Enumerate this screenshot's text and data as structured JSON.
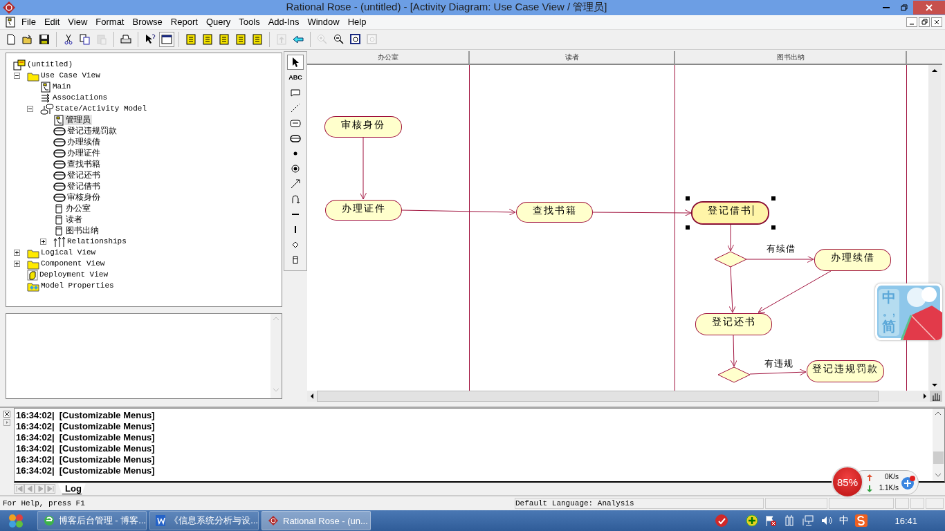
{
  "window": {
    "title": "Rational Rose - (untitled) - [Activity Diagram: Use Case View / 管理员]"
  },
  "menu": [
    "File",
    "Edit",
    "View",
    "Format",
    "Browse",
    "Report",
    "Query",
    "Tools",
    "Add-Ins",
    "Window",
    "Help"
  ],
  "toolbar": [
    {
      "kind": "new",
      "disabled": false,
      "pressed": false
    },
    {
      "kind": "open",
      "disabled": false,
      "pressed": false
    },
    {
      "kind": "save",
      "disabled": false,
      "pressed": false
    },
    {
      "kind": "separator"
    },
    {
      "kind": "cut",
      "disabled": false,
      "pressed": false
    },
    {
      "kind": "copy",
      "disabled": false,
      "pressed": false
    },
    {
      "kind": "paste",
      "disabled": true,
      "pressed": false
    },
    {
      "kind": "separator"
    },
    {
      "kind": "print",
      "disabled": false,
      "pressed": false
    },
    {
      "kind": "separator"
    },
    {
      "kind": "help",
      "disabled": false,
      "pressed": false
    },
    {
      "kind": "window",
      "disabled": false,
      "pressed": true
    },
    {
      "kind": "separator"
    },
    {
      "kind": "diagram",
      "disabled": false,
      "pressed": false
    },
    {
      "kind": "diagram",
      "disabled": false,
      "pressed": false
    },
    {
      "kind": "diagram",
      "disabled": false,
      "pressed": false
    },
    {
      "kind": "diagram",
      "disabled": false,
      "pressed": false
    },
    {
      "kind": "diagram",
      "disabled": false,
      "pressed": false
    },
    {
      "kind": "separator"
    },
    {
      "kind": "up",
      "disabled": true,
      "pressed": false
    },
    {
      "kind": "back",
      "disabled": false,
      "pressed": false
    },
    {
      "kind": "separator"
    },
    {
      "kind": "zoom-in",
      "disabled": true,
      "pressed": false
    },
    {
      "kind": "zoom-out",
      "disabled": false,
      "pressed": false
    },
    {
      "kind": "fit",
      "disabled": false,
      "pressed": false
    },
    {
      "kind": "fit",
      "disabled": true,
      "pressed": false
    }
  ],
  "browser": {
    "tree": {
      "label": "(untitled)",
      "kind": "model",
      "selected": false,
      "children": [
        {
          "label": "Use Case View",
          "kind": "folder",
          "expanded": true,
          "selected": false,
          "children": [
            {
              "label": "Main",
              "kind": "diagram",
              "selected": false
            },
            {
              "label": "Associations",
              "kind": "associations",
              "selected": false
            },
            {
              "label": "State/Activity Model",
              "kind": "state-model",
              "expanded": true,
              "selected": false,
              "children": [
                {
                  "label": "管理员",
                  "kind": "diagram",
                  "selected": true
                },
                {
                  "label": "登记违规罚款",
                  "kind": "activity",
                  "selected": false
                },
                {
                  "label": "办理续借",
                  "kind": "activity",
                  "selected": false
                },
                {
                  "label": "办理证件",
                  "kind": "activity",
                  "selected": false
                },
                {
                  "label": "查找书籍",
                  "kind": "activity",
                  "selected": false
                },
                {
                  "label": "登记还书",
                  "kind": "activity",
                  "selected": false
                },
                {
                  "label": "登记借书",
                  "kind": "activity",
                  "selected": false
                },
                {
                  "label": "审核身份",
                  "kind": "activity",
                  "selected": false
                },
                {
                  "label": "办公室",
                  "kind": "swimlane",
                  "selected": false
                },
                {
                  "label": "读者",
                  "kind": "swimlane",
                  "selected": false
                },
                {
                  "label": "图书出纳",
                  "kind": "swimlane",
                  "selected": false
                },
                {
                  "label": "Relationships",
                  "kind": "relationships",
                  "expanded": false,
                  "selected": false
                }
              ]
            }
          ]
        },
        {
          "label": "Logical View",
          "kind": "folder",
          "expanded": false,
          "selected": false
        },
        {
          "label": "Component View",
          "kind": "folder",
          "expanded": false,
          "selected": false
        },
        {
          "label": "Deployment View",
          "kind": "deployment",
          "selected": false
        },
        {
          "label": "Model Properties",
          "kind": "properties",
          "selected": false
        }
      ]
    }
  },
  "palette": [
    {
      "kind": "pointer",
      "selected": true
    },
    {
      "kind": "text",
      "label": "ABC",
      "selected": false
    },
    {
      "kind": "note",
      "selected": false
    },
    {
      "kind": "anchor",
      "selected": false
    },
    {
      "kind": "state",
      "selected": false
    },
    {
      "kind": "activity",
      "selected": false
    },
    {
      "kind": "start",
      "selected": false
    },
    {
      "kind": "end",
      "selected": false
    },
    {
      "kind": "transition",
      "selected": false
    },
    {
      "kind": "loop",
      "selected": false
    },
    {
      "kind": "hbar",
      "selected": false
    },
    {
      "kind": "vbar",
      "selected": false
    },
    {
      "kind": "decision",
      "selected": false
    },
    {
      "kind": "swimlane",
      "selected": false
    }
  ],
  "diagram": {
    "swimlanes": [
      {
        "label": "办公室"
      },
      {
        "label": "读者"
      },
      {
        "label": "图书出纳"
      }
    ],
    "nodes": [
      {
        "kind": "activity",
        "label": "审核身份",
        "selected": false
      },
      {
        "kind": "activity",
        "label": "办理证件",
        "selected": false
      },
      {
        "kind": "activity",
        "label": "查找书籍",
        "selected": false
      },
      {
        "kind": "activity",
        "label": "登记借书",
        "selected": true
      },
      {
        "kind": "decision"
      },
      {
        "kind": "activity",
        "label": "办理续借",
        "selected": false
      },
      {
        "kind": "activity",
        "label": "登记还书",
        "selected": false
      },
      {
        "kind": "decision"
      },
      {
        "kind": "activity",
        "label": "登记违规罚款",
        "selected": false
      }
    ],
    "guards": [
      {
        "label": "有续借"
      },
      {
        "label": "有违规"
      }
    ]
  },
  "ime_widget": {
    "mode": "中",
    "punctuation": "。,",
    "script": "简"
  },
  "log": {
    "lines": [
      {
        "time": "16:34:02|",
        "text": "[Customizable Menus]"
      },
      {
        "time": "16:34:02|",
        "text": "[Customizable Menus]"
      },
      {
        "time": "16:34:02|",
        "text": "[Customizable Menus]"
      },
      {
        "time": "16:34:02|",
        "text": "[Customizable Menus]"
      },
      {
        "time": "16:34:02|",
        "text": "[Customizable Menus]"
      },
      {
        "time": "16:34:02|",
        "text": "[Customizable Menus]"
      }
    ],
    "tabs": [
      {
        "label": "Log",
        "selected": true
      }
    ]
  },
  "net_widget": {
    "usage": "85%",
    "upload": "0K/s",
    "download": "1.1K/s"
  },
  "status_bar": {
    "help": "For Help, press F1",
    "language": "Default Language: Analysis"
  },
  "taskbar": {
    "tasks": [
      {
        "label": "博客后台管理 - 博客...",
        "kind": "browser",
        "selected": false
      },
      {
        "label": "《信息系统分析与设...",
        "kind": "word",
        "selected": false
      },
      {
        "label": "Rational Rose - (un...",
        "kind": "rose",
        "selected": true
      }
    ],
    "input_method": "中",
    "clock": "16:41"
  }
}
